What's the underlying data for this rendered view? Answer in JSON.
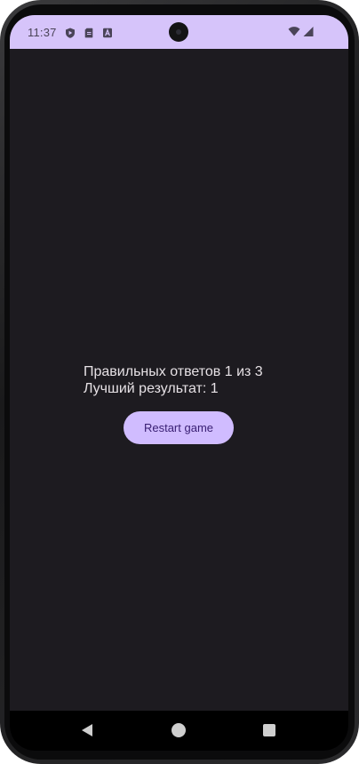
{
  "status_bar": {
    "time": "11:37",
    "icons": [
      "play-protect-icon",
      "sim-card-icon",
      "accessibility-a-icon",
      "wifi-icon",
      "cellular-signal-icon"
    ]
  },
  "game": {
    "correct_answers_line": "Правильных ответов 1 из 3",
    "best_result_line": "Лучший результат: 1",
    "restart_label": "Restart game"
  },
  "nav_bar": {
    "buttons": [
      "back-icon",
      "home-icon",
      "recents-icon"
    ]
  },
  "colors": {
    "status_bar_bg": "#d6c4fa",
    "screen_bg": "#1d1b20",
    "button_bg": "#d0bcff",
    "button_text": "#381e72",
    "text": "#e6e1e5"
  }
}
